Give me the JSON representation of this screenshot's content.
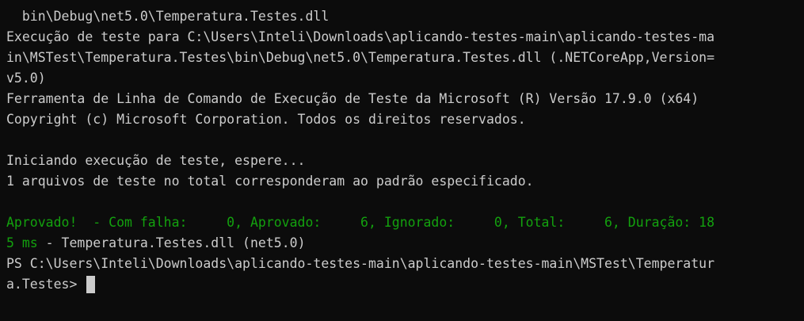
{
  "terminal": {
    "lines": [
      "  bin\\Debug\\net5.0\\Temperatura.Testes.dll",
      "Execução de teste para C:\\Users\\Inteli\\Downloads\\aplicando-testes-main\\aplicando-testes-ma",
      "in\\MSTest\\Temperatura.Testes\\bin\\Debug\\net5.0\\Temperatura.Testes.dll (.NETCoreApp,Version=",
      "v5.0)",
      "Ferramenta de Linha de Comando de Execução de Teste da Microsoft (R) Versão 17.9.0 (x64)",
      "Copyright (c) Microsoft Corporation. Todos os direitos reservados.",
      "",
      "Iniciando execução de teste, espere...",
      "1 arquivos de teste no total corresponderam ao padrão especificado.",
      ""
    ],
    "result_green": "Aprovado!  - Com falha:     0, Aprovado:     6, Ignorado:     0, Total:     6, Duração: 18",
    "result_rest_green": "5 ms",
    "result_rest_plain": " - Temperatura.Testes.dll (net5.0)",
    "prompt_line1": "PS C:\\Users\\Inteli\\Downloads\\aplicando-testes-main\\aplicando-testes-main\\MSTest\\Temperatur",
    "prompt_line2": "a.Testes> "
  },
  "colors": {
    "background": "#0c0c0c",
    "text": "#cccccc",
    "success": "#13a10e"
  }
}
